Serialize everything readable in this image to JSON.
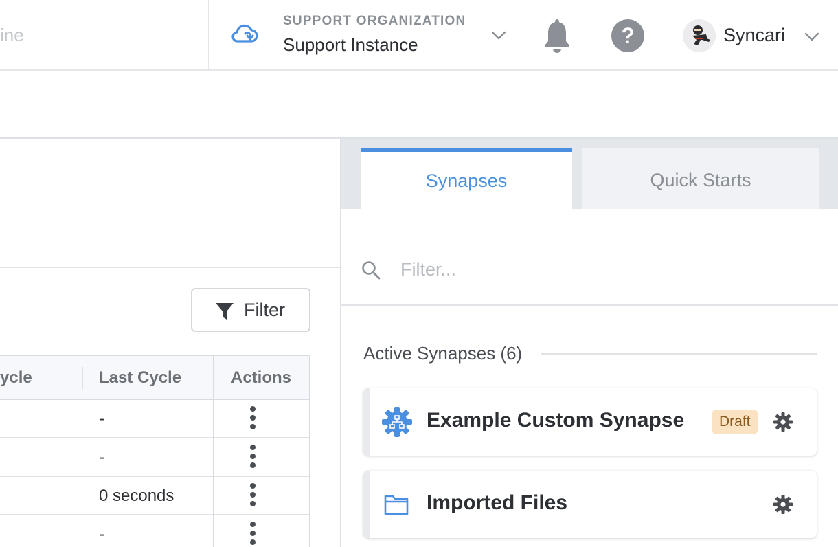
{
  "header": {
    "search_fragment": "ine",
    "org_label": "SUPPORT ORGANIZATION",
    "org_name": "Support Instance",
    "user_name": "Syncari"
  },
  "left_panel": {
    "filter_label": "Filter",
    "table": {
      "columns": [
        "ycle",
        "Last Cycle",
        "Actions"
      ],
      "rows": [
        {
          "last_cycle": "-"
        },
        {
          "last_cycle": "-"
        },
        {
          "last_cycle": "0 seconds"
        },
        {
          "last_cycle": "-"
        }
      ]
    }
  },
  "right_panel": {
    "tabs": [
      {
        "label": "Synapses",
        "active": true
      },
      {
        "label": "Quick Starts",
        "active": false
      }
    ],
    "filter_placeholder": "Filter...",
    "section_title": "Active Synapses (6)",
    "cards": [
      {
        "title": "Example Custom Synapse",
        "badge": "Draft",
        "icon": "custom-synapse-gear-icon"
      },
      {
        "title": "Imported Files",
        "badge": "",
        "icon": "folder-icon"
      }
    ]
  },
  "colors": {
    "accent": "#4a8fe0",
    "badge_bg": "#fbe2c3",
    "badge_text": "#8a5a1e",
    "icon_gray": "#8c9096"
  }
}
